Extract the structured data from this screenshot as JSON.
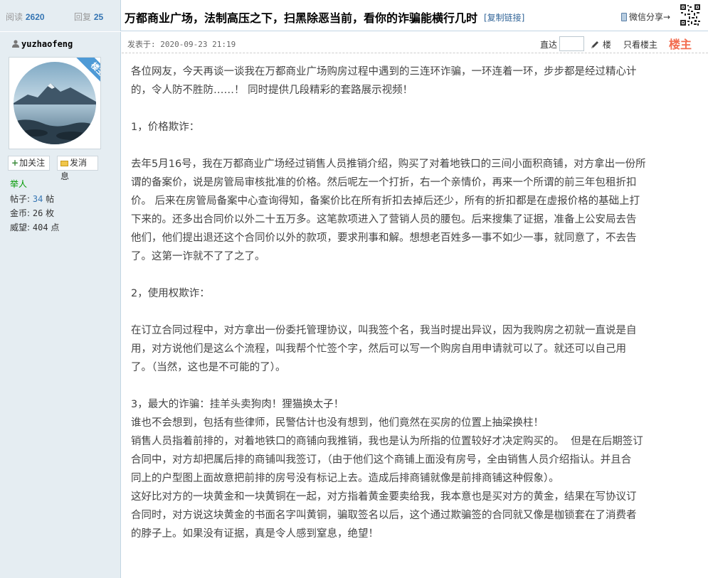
{
  "header": {
    "views_label": "阅读",
    "views_count": "2620",
    "replies_label": "回复",
    "replies_count": "25",
    "thread_title": "万都商业广场，法制高压之下，扫黑除恶当前，看你的诈骗能横行几时",
    "copy_link": "[复制链接]",
    "wechat_share": "微信分享→"
  },
  "author": {
    "username": "yuzhaofeng",
    "badge": "楼主",
    "follow_button": "加关注",
    "message_button": "发消息",
    "rank": "举人",
    "posts_label": "帖子:",
    "posts_value": "34",
    "posts_unit": "帖",
    "coins_label": "金币:",
    "coins_value": "26",
    "coins_unit": "枚",
    "prestige_label": "威望:",
    "prestige_value": "404",
    "prestige_unit": "点"
  },
  "post": {
    "posted_at": "发表于: 2020-09-23 21:19",
    "jump_label": "直达",
    "floor_label": "楼",
    "only_op": "只看楼主",
    "op_badge": "楼主",
    "lines": [
      "各位网友，今天再谈一谈我在万都商业广场购房过程中遇到的三连环诈骗，一环连着一环，步步都是经过精心计",
      "的，令人防不胜防……！ 同时提供几段精彩的套路展示视频！",
      "",
      "1，价格欺诈：",
      "",
      "去年5月16号，我在万都商业广场经过销售人员推销介绍，购买了对着地铁口的三间小面积商铺，对方拿出一份所",
      "谓的备案价，说是房管局审核批准的价格。然后呢左一个打折，右一个亲情价，再来一个所谓的前三年包租折扣",
      "价。 后来在房管局备案中心查询得知，备案价比在所有折扣去掉后还少，所有的折扣都是在虚报价格的基础上打",
      "下来的。还多出合同价以外二十五万多。这笔款项进入了营销人员的腰包。后来搜集了证据，准备上公安局去告",
      "他们，他们提出退还这个合同价以外的款项，要求刑事和解。想想老百姓多一事不如少一事，就同意了，不去告",
      "了。这第一诈就不了了之了。",
      "",
      "2，使用权欺诈：",
      "",
      "在订立合同过程中，对方拿出一份委托管理协议，叫我签个名，我当时提出异议，因为我购房之初就一直说是自",
      "用，对方说他们是这么个流程，叫我帮个忙签个字，然后可以写一个购房自用申请就可以了。就还可以自己用",
      "了。（当然，这也是不可能的了）。",
      "",
      "3，最大的诈骗：挂羊头卖狗肉！狸猫换太子！",
      "谁也不会想到，包括有些律师，民警估计也没有想到，他们竟然在买房的位置上抽梁换柱！",
      "销售人员指着前排的，对着地铁口的商铺向我推销，我也是认为所指的位置较好才决定购买的。  但是在后期签订",
      "合同中，对方却把属后排的商铺叫我签订，（由于他们这个商铺上面没有房号，全由销售人员介绍指认。并且合",
      "同上的户型图上面故意把前排的房号没有标记上去。造成后排商铺就像是前排商铺这种假象）。",
      "这好比对方的一块黄金和一块黄铜在一起，对方指着黄金要卖给我，我本意也是买对方的黄金，结果在写协议订",
      "合同时，对方说这块黄金的书面名字叫黄铜，骗取签名以后，这个通过欺骗签的合同就又像是枷锁套在了消费者",
      "的脖子上。如果没有证据，真是令人感到窒息，绝望！"
    ]
  },
  "colors": {
    "sidebar_bg": "#e5edf2",
    "border": "#c2d5e3",
    "link_blue": "#3575b3",
    "op_orange": "#f26c4f",
    "rank_green": "#009900"
  },
  "icons": {
    "user": "user-icon",
    "phone": "phone-icon",
    "qr": "qr-code-icon",
    "pen": "pen-icon",
    "envelope": "envelope-icon",
    "plus": "plus-icon"
  }
}
